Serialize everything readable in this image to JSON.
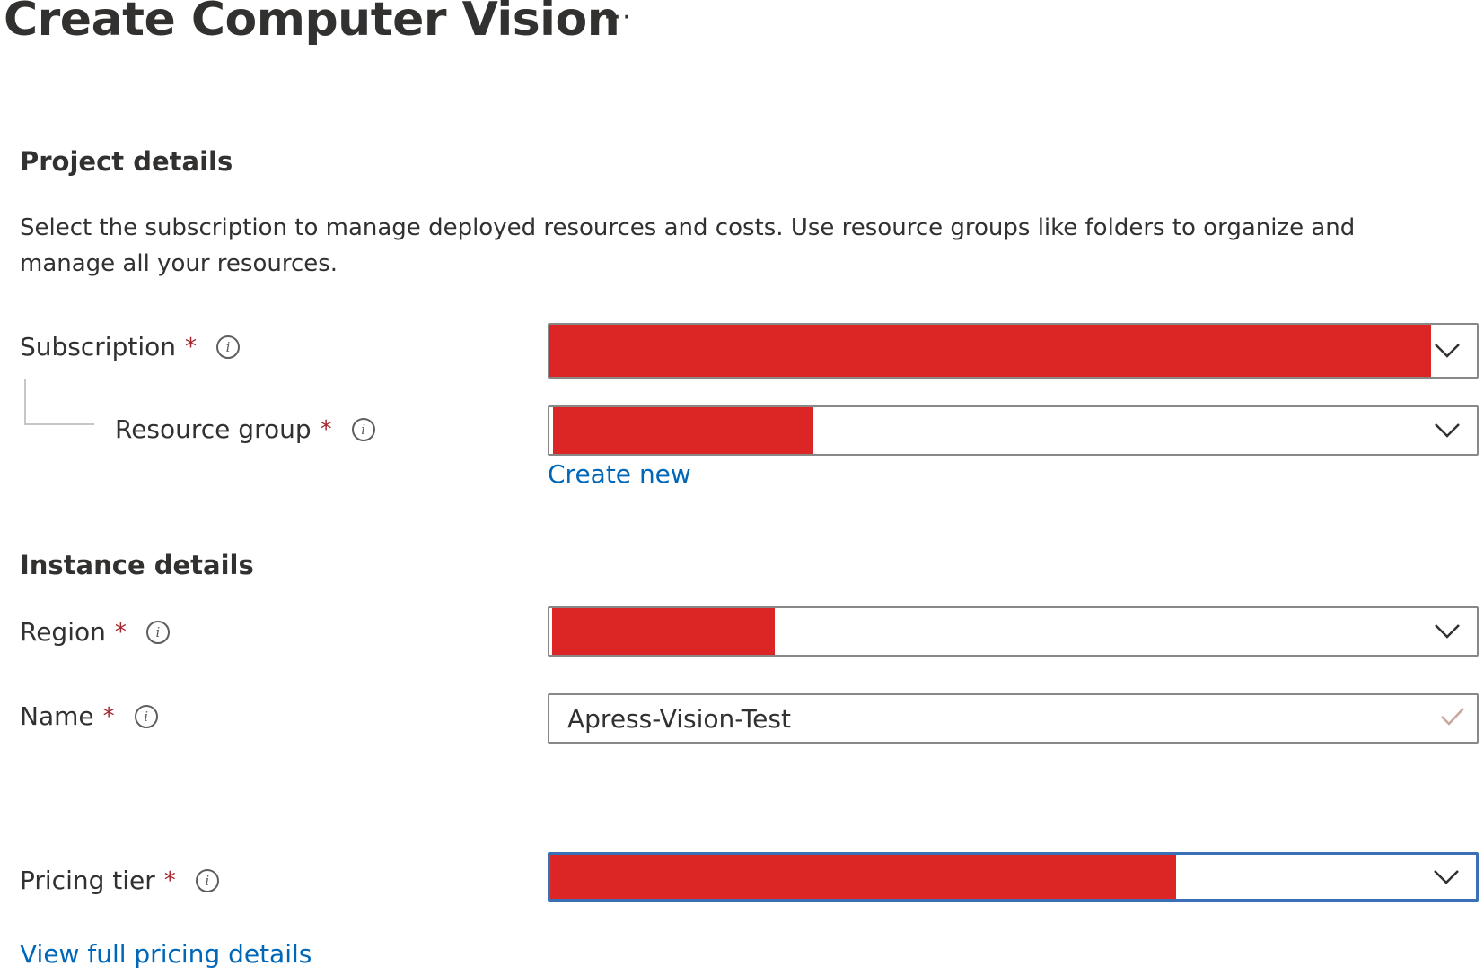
{
  "header": {
    "title": "Create Computer Vision",
    "more_label": "···"
  },
  "project_details": {
    "heading": "Project details",
    "description": "Select the subscription to manage deployed resources and costs. Use resource groups like folders to organize and manage all your resources.",
    "subscription": {
      "label": "Subscription",
      "required_mark": "*",
      "info_glyph": "i",
      "icon": "info-icon"
    },
    "resource_group": {
      "label": "Resource group",
      "required_mark": "*",
      "info_glyph": "i",
      "icon": "info-icon",
      "create_new_label": "Create new"
    }
  },
  "instance_details": {
    "heading": "Instance details",
    "region": {
      "label": "Region",
      "required_mark": "*",
      "info_glyph": "i",
      "icon": "info-icon"
    },
    "name": {
      "label": "Name",
      "required_mark": "*",
      "info_glyph": "i",
      "icon": "info-icon",
      "value": "Apress-Vision-Test",
      "validation_icon": "checkmark-icon"
    }
  },
  "pricing": {
    "label": "Pricing tier",
    "required_mark": "*",
    "info_glyph": "i",
    "icon": "info-icon",
    "view_details_label": "View full pricing details"
  },
  "colors": {
    "redaction": "#dc2626",
    "link": "#0067b8",
    "required": "#a4262c",
    "focus_border": "#3b6fb6",
    "valid_check": "#c8a79a"
  }
}
